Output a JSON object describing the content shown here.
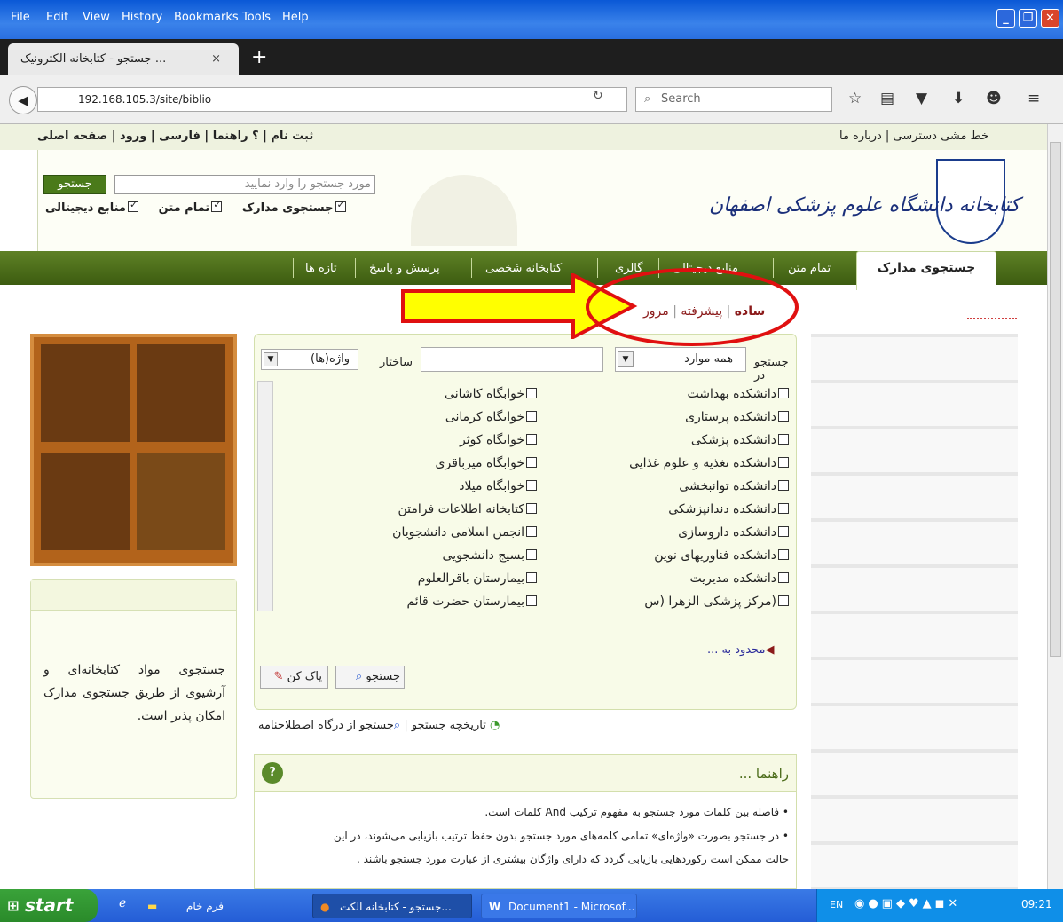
{
  "menubar": {
    "items": [
      "File",
      "Edit",
      "View",
      "History",
      "Bookmarks",
      "Tools",
      "Help"
    ]
  },
  "tab": {
    "title": "جستجو - کتابخانه الکترونیک ...",
    "close": "×",
    "new": "+"
  },
  "nav": {
    "url": "192.168.105.3/site/biblio",
    "search_placeholder": "Search"
  },
  "toplinks": {
    "left": "خط مشی دسترسی | درباره ما",
    "right": "ثبت نام | ؟ راهنما | فارسی | ورود | صفحه اصلی"
  },
  "header": {
    "logo_text": "کتابخانه دانشگاه علوم پزشکی اصفهان",
    "search_placeholder": "مورد جستجو را وارد نمایید",
    "search_button": "جستجو",
    "opt1": "جستجوی مدارک",
    "opt2": "تمام متن",
    "opt3": "منابع دیجیتالی"
  },
  "mainnav": {
    "active": "جستجوی مدارک",
    "items": [
      "تمام متن",
      "منابع دیجیتالی",
      "گالری",
      "کتابخانه شخصی",
      "پرسش و پاسخ",
      "تازه ها"
    ]
  },
  "subtabs": {
    "simple": "ساده",
    "sep": "|",
    "advanced": "پیشرفته",
    "browse": "مرور"
  },
  "form": {
    "search_in_label": "جستجو در",
    "search_in_value": "همه موارد",
    "structure_label": "ساختار",
    "structure_value": "واژه(ها)",
    "right_col": [
      "دانشکده بهداشت",
      "دانشکده پرستاری",
      "دانشکده پزشکی",
      "دانشکده تغذیه و علوم غذایی",
      "دانشکده توانبخشی",
      "دانشکده دندانپزشکی",
      "دانشکده داروسازی",
      "دانشکده فناوریهای نوین",
      "دانشکده مدیریت",
      "(مرکز پزشکی الزهرا (س"
    ],
    "left_col": [
      "خوابگاه کاشانی",
      "خوابگاه کرمانی",
      "خوابگاه کوثر",
      "خوابگاه میرباقری",
      "خوابگاه میلاد",
      "کتابخانه اطلاعات فرامتن",
      "انجمن اسلامی دانشجویان",
      "بسیج دانشجویی",
      "بیمارستان باقرالعلوم",
      "بیمارستان حضرت قائم"
    ],
    "limit": "محدود به ...",
    "search_btn": "جستجو",
    "clear_btn": "پاک کن"
  },
  "below_form": {
    "history": "تاریخچه جستجو",
    "thesaurus": "جستجو از درگاه اصطلاحنامه"
  },
  "leftbox": {
    "text": "جستجوی مواد کتابخانه‌ای و آرشیوی از طریق جستجوی مدارک امکان پذیر است."
  },
  "help": {
    "title": "راهنما ...",
    "line1": "• فاصله بین کلمات مورد جستجو به مفهوم ترکیب And کلمات است.",
    "line2": "• در جستجو بصورت «واژه‌ای» تمامی کلمه‌های مورد جستجو بدون حفظ ترتیب بازیابی می‌شوند، در این",
    "line3": "حالت ممکن است رکوردهایی بازیابی گردد که دارای واژگان بیشتری از عبارت مورد جستجو باشند ."
  },
  "taskbar": {
    "start": "start",
    "folder": "فرم خام",
    "firefox": "جستجو - کتابخانه الکت...",
    "word": "Document1 - Microsof...",
    "lang": "EN",
    "time": "09:21"
  },
  "colors": {
    "nav_green": "#4a6b18",
    "arrow_yellow": "#ffff00",
    "circle_red": "#e01010"
  }
}
